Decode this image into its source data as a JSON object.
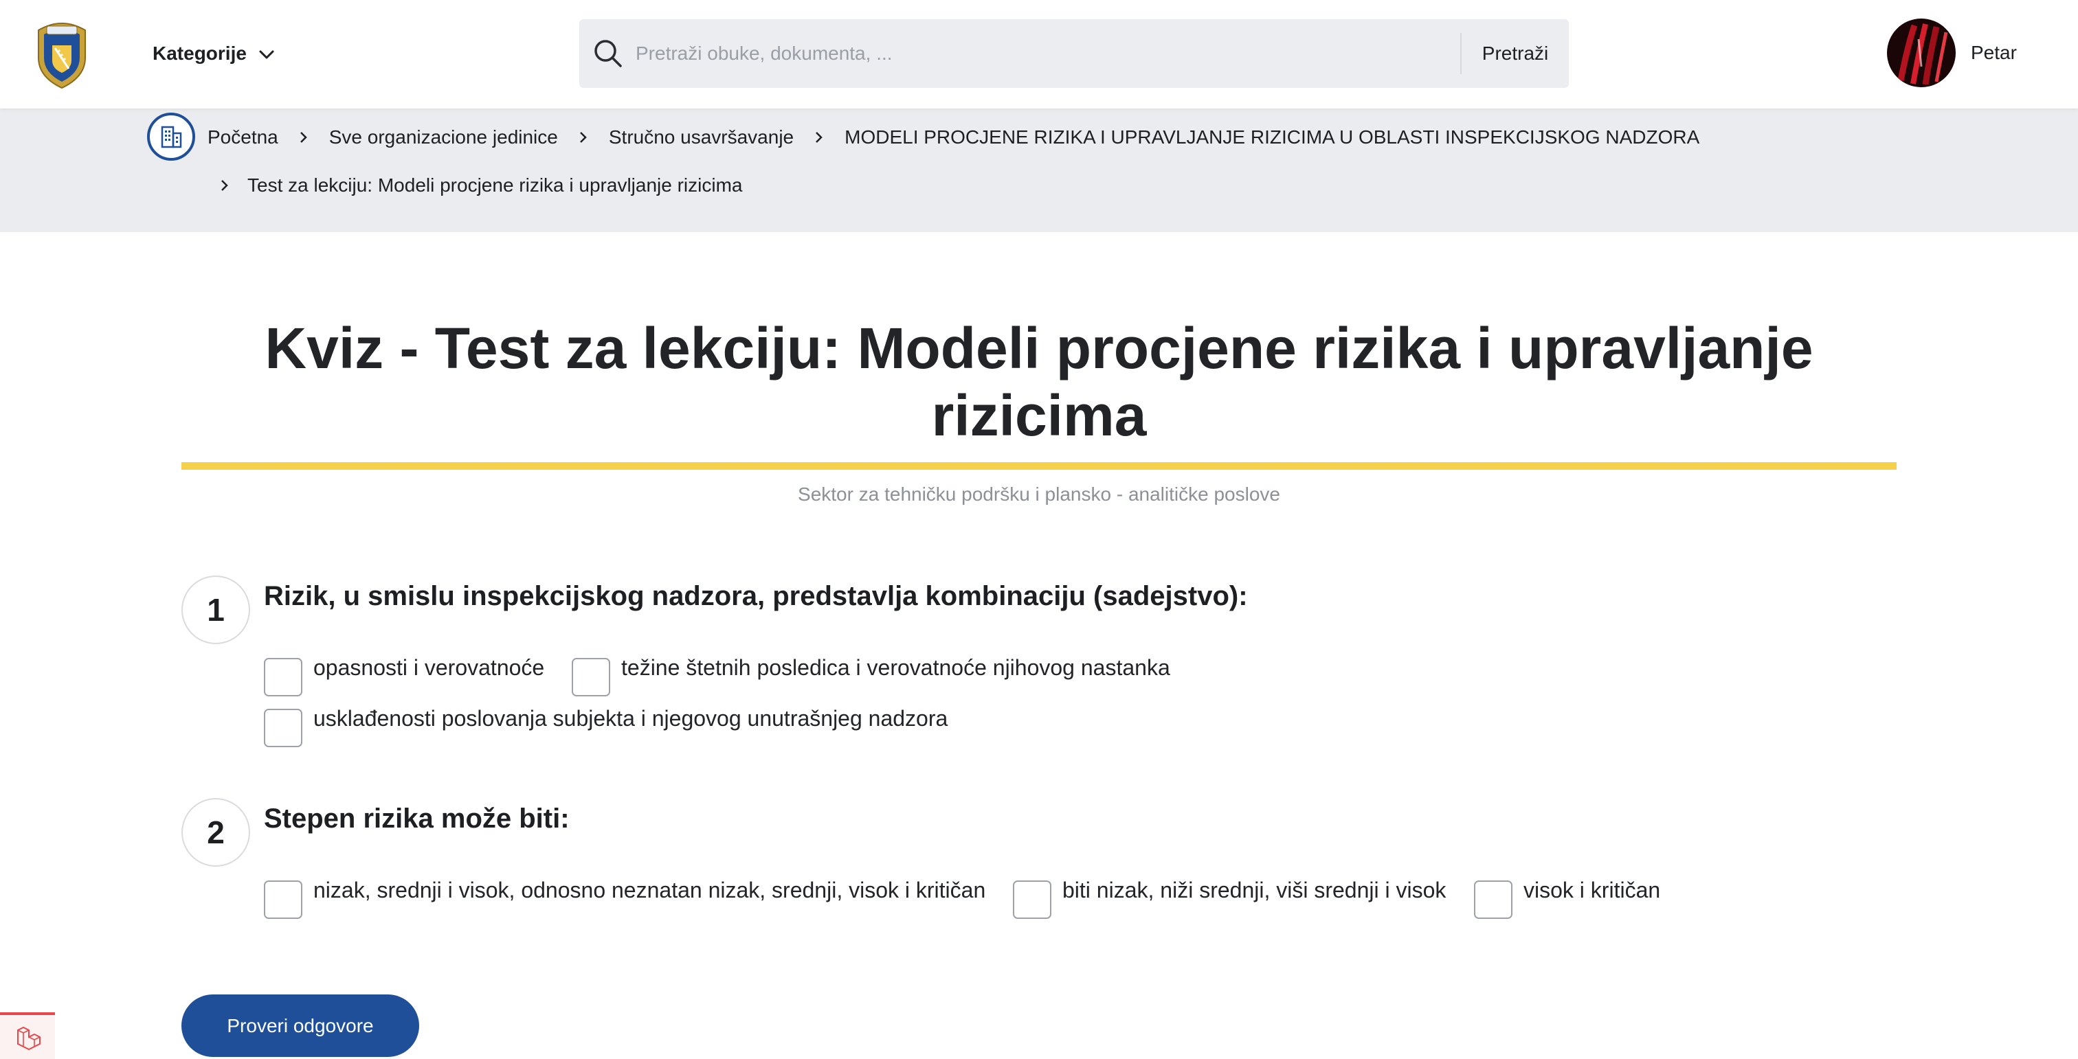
{
  "header": {
    "logo": "police-crest-logo",
    "categories_label": "Kategorije",
    "search": {
      "placeholder": "Pretraži obuke, dokumenta, ...",
      "value": "",
      "button_label": "Pretraži"
    },
    "user": {
      "name": "Petar"
    }
  },
  "breadcrumb": {
    "items": [
      "Početna",
      "Sve organizacione jedinice",
      "Stručno usavršavanje",
      "MODELI PROCJENE RIZIKA I UPRAVLJANJE RIZICIMA U OBLASTI INSPEKCIJSKOG NADZORA",
      "Test za lekciju: Modeli procjene rizika i upravljanje rizicima"
    ]
  },
  "page": {
    "title": "Kviz - Test za lekciju: Modeli procjene rizika i upravljanje rizicima",
    "subtitle": "Sektor za tehničku podršku i plansko - analitičke poslove",
    "accent_color": "#f5d14b",
    "primary_color": "#1f4f99"
  },
  "questions": [
    {
      "number": "1",
      "text": "Rizik, u smislu inspekcijskog nadzora, predstavlja kombinaciju (sadejstvo):",
      "options": [
        {
          "label": "opasnosti i verovatnoće",
          "checked": false
        },
        {
          "label": "težine štetnih posledica i verovatnoće njihovog nastanka",
          "checked": false
        },
        {
          "label": "usklađenosti poslovanja subjekta i njegovog unutrašnjeg nadzora",
          "checked": false
        }
      ]
    },
    {
      "number": "2",
      "text": "Stepen rizika može biti:",
      "options": [
        {
          "label": "nizak, srednji i visok, odnosno neznatan nizak, srednji, visok i kritičan",
          "checked": false
        },
        {
          "label": "biti nizak, niži srednji, viši srednji i visok",
          "checked": false
        },
        {
          "label": "visok i kritičan",
          "checked": false
        }
      ]
    }
  ],
  "actions": {
    "check_answers_label": "Proveri odgovore"
  },
  "debug_badge": "laravel-icon"
}
